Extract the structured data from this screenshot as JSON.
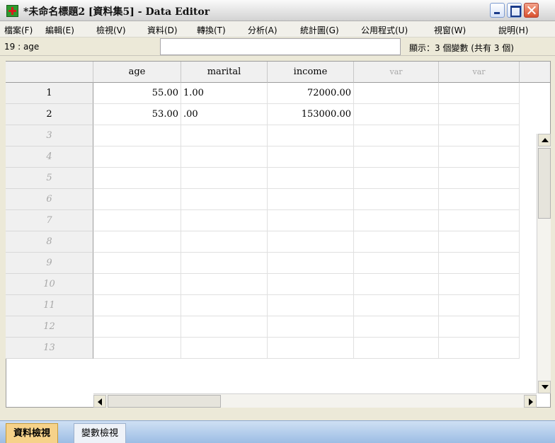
{
  "window": {
    "title": "*未命名標題2 [資料集5] - Data Editor",
    "icon": "spss-data-editor-icon"
  },
  "menu": [
    {
      "label": "檔案(F)"
    },
    {
      "label": "編輯(E)"
    },
    {
      "label": "檢視(V)"
    },
    {
      "label": "資料(D)"
    },
    {
      "label": "轉換(T)"
    },
    {
      "label": "分析(A)"
    },
    {
      "label": "統計圖(G)"
    },
    {
      "label": "公用程式(U)"
    },
    {
      "label": "視窗(W)"
    },
    {
      "label": "說明(H)"
    }
  ],
  "cellbar": {
    "ref": "19 : age",
    "value": "",
    "show": "顯示：3 個變數 (共有 3 個)"
  },
  "grid": {
    "columns": [
      "age",
      "marital",
      "income",
      "var",
      "var"
    ],
    "rows": [
      {
        "num": "1",
        "age": "55.00",
        "marital": "1.00",
        "income": "72000.00"
      },
      {
        "num": "2",
        "age": "53.00",
        "marital": ".00",
        "income": "153000.00"
      },
      {
        "num": "3"
      },
      {
        "num": "4"
      },
      {
        "num": "5"
      },
      {
        "num": "6"
      },
      {
        "num": "7"
      },
      {
        "num": "8"
      },
      {
        "num": "9"
      },
      {
        "num": "10"
      },
      {
        "num": "11"
      },
      {
        "num": "12"
      },
      {
        "num": "13"
      }
    ]
  },
  "tabs": {
    "data_view": "資料檢視",
    "variable_view": "變數檢視"
  }
}
